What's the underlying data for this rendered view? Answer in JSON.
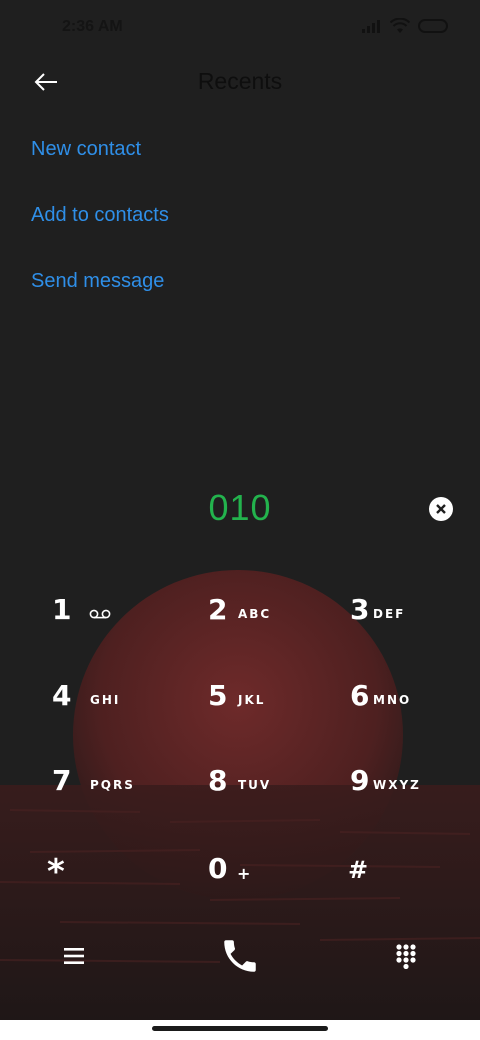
{
  "status_bar": {
    "time": "2:36 AM",
    "icons": [
      "signal-icon",
      "wifi-icon",
      "battery-icon"
    ]
  },
  "header": {
    "title": "Recents",
    "back_icon": "arrow-left-icon"
  },
  "actions": [
    {
      "label": "New contact"
    },
    {
      "label": "Add to contacts"
    },
    {
      "label": "Send message"
    }
  ],
  "dialer": {
    "number": "010",
    "number_color": "#23b34d",
    "clear_icon": "clear-circle-icon",
    "keys": [
      {
        "digit": "1",
        "letters": "",
        "icon": "voicemail-icon"
      },
      {
        "digit": "2",
        "letters": "ABC"
      },
      {
        "digit": "3",
        "letters": "DEF"
      },
      {
        "digit": "4",
        "letters": "GHI"
      },
      {
        "digit": "5",
        "letters": "JKL"
      },
      {
        "digit": "6",
        "letters": "MNO"
      },
      {
        "digit": "7",
        "letters": "PQRS"
      },
      {
        "digit": "8",
        "letters": "TUV"
      },
      {
        "digit": "9",
        "letters": "WXYZ"
      },
      {
        "digit": "*",
        "letters": ""
      },
      {
        "digit": "0",
        "letters": "+"
      },
      {
        "digit": "#",
        "letters": ""
      }
    ]
  },
  "bottom_bar": {
    "menu_icon": "menu-icon",
    "call_icon": "phone-call-icon",
    "keypad_icon": "dialpad-icon"
  },
  "colors": {
    "background": "#1f1f1f",
    "link": "#2f8fe8",
    "key_text": "#ffffff"
  }
}
